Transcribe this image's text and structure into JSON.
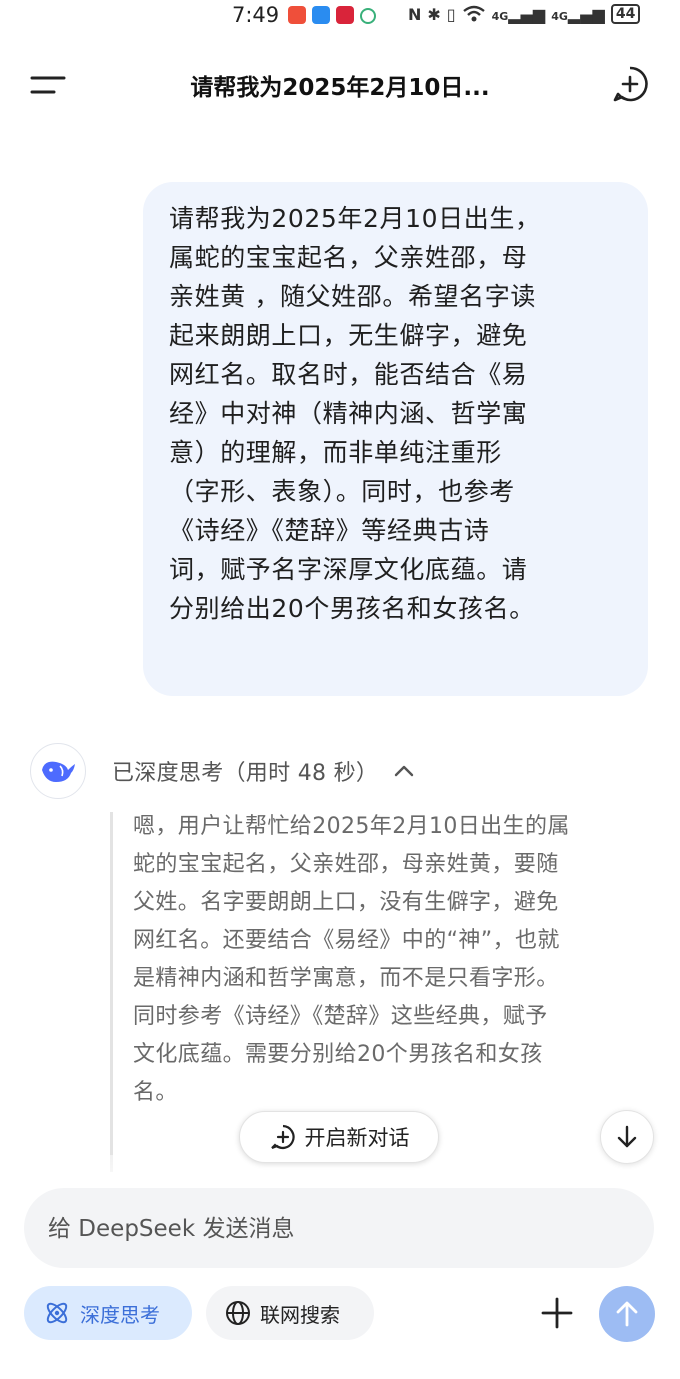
{
  "status_bar": {
    "time": "7:49",
    "app_icons": [
      {
        "name": "taobao-icon",
        "color": "#ef4f3a"
      },
      {
        "name": "app-blue-icon",
        "color": "#2a8cf0"
      },
      {
        "name": "tmall-icon",
        "color": "#d9243a"
      },
      {
        "name": "sync-icon",
        "color": "#39b07a"
      }
    ],
    "network_1": "4G",
    "network_2": "4G",
    "battery": "44"
  },
  "header": {
    "title": "请帮我为2025年2月10日..."
  },
  "user_message": {
    "lines": [
      "请帮我为2025年2月10日出生，",
      "属蛇的宝宝起名，父亲姓邵，母",
      "亲姓黄 ，随父姓邵。希望名字读",
      "起来朗朗上口，无生僻字，避免",
      "网红名。取名时，能否结合《易",
      "经》中对神（精神内涵、哲学寓",
      "意）的理解，而非单纯注重形",
      "（字形、表象）。同时，也参考",
      "《诗经》《楚辞》等经典古诗",
      "词，赋予名字深厚文化底蕴。请",
      "分别给出20个男孩名和女孩名。"
    ]
  },
  "assistant": {
    "thinking_label": "已深度思考（用时 48 秒）",
    "thinking_lines": [
      "嗯，用户让帮忙给2025年2月10日出生的属",
      "蛇的宝宝起名，父亲姓邵，母亲姓黄，要随",
      "父姓。名字要朗朗上口，没有生僻字，避免",
      "网红名。还要结合《易经》中的“神”，也就",
      "是精神内涵和哲学寓意，而不是只看字形。",
      "同时参考《诗经》《楚辞》这些经典，赋予",
      "文化底蕴。需要分别给20个男孩名和女孩",
      "名。"
    ]
  },
  "floating": {
    "new_dialog_label": "开启新对话"
  },
  "composer": {
    "placeholder": "给 DeepSeek 发送消息",
    "value": "",
    "deep_think_label": "深度思考",
    "web_search_label": "联网搜索"
  },
  "colors": {
    "accent": "#4d6bfe",
    "bubble_bg": "#eff4fd",
    "chip_active_bg": "#dbeafe",
    "send_button": "#9dbcf3"
  }
}
